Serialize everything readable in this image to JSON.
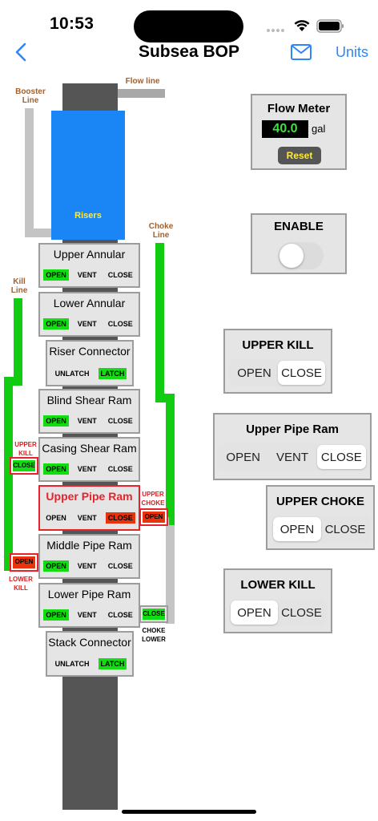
{
  "status": {
    "time": "10:53"
  },
  "nav": {
    "title": "Subsea BOP",
    "units_label": "Units"
  },
  "diagram": {
    "flow_line": "Flow line",
    "booster_line": "Booster Line",
    "risers": "Risers",
    "choke_line": "Choke Line",
    "kill_line": "Kill Line",
    "upper_kill_label": "UPPER KILL",
    "upper_kill_valve": "CLOSE",
    "lower_kill_label": "LOWER KILL",
    "lower_kill_valve": "OPEN",
    "upper_choke_label": "UPPER CHOKE",
    "upper_choke_valve": "OPEN",
    "choke_lower_label": "CHOKE LOWER",
    "choke_lower_valve": "CLOSE"
  },
  "stack": [
    {
      "title": "Upper Annular",
      "opts": [
        "OPEN",
        "VENT",
        "CLOSE"
      ]
    },
    {
      "title": "Lower Annular",
      "opts": [
        "OPEN",
        "VENT",
        "CLOSE"
      ]
    },
    {
      "title": "Riser Connector",
      "opts": [
        "UNLATCH",
        "LATCH"
      ]
    },
    {
      "title": "Blind Shear Ram",
      "opts": [
        "OPEN",
        "VENT",
        "CLOSE"
      ]
    },
    {
      "title": "Casing Shear Ram",
      "opts": [
        "OPEN",
        "VENT",
        "CLOSE"
      ]
    },
    {
      "title": "Upper Pipe Ram",
      "opts": [
        "OPEN",
        "VENT",
        "CLOSE"
      ]
    },
    {
      "title": "Middle Pipe Ram",
      "opts": [
        "OPEN",
        "VENT",
        "CLOSE"
      ]
    },
    {
      "title": "Lower Pipe Ram",
      "opts": [
        "OPEN",
        "VENT",
        "CLOSE"
      ]
    },
    {
      "title": "Stack Connector",
      "opts": [
        "UNLATCH",
        "LATCH"
      ]
    }
  ],
  "flow_meter": {
    "title": "Flow Meter",
    "value": "40.0",
    "unit": "gal",
    "reset": "Reset"
  },
  "enable": {
    "title": "ENABLE",
    "on": false
  },
  "upper_kill": {
    "title": "UPPER KILL",
    "opts": [
      "OPEN",
      "CLOSE"
    ],
    "selected": "CLOSE"
  },
  "upper_pipe_ram": {
    "title": "Upper Pipe Ram",
    "opts": [
      "OPEN",
      "VENT",
      "CLOSE"
    ],
    "selected": "CLOSE"
  },
  "upper_choke": {
    "title": "UPPER CHOKE",
    "opts": [
      "OPEN",
      "CLOSE"
    ],
    "selected": "OPEN"
  },
  "lower_kill": {
    "title": "LOWER KILL",
    "opts": [
      "OPEN",
      "CLOSE"
    ],
    "selected": "OPEN"
  },
  "colors": {
    "accent": "#2f86f6",
    "green": "#11dd11",
    "red": "#e8330c",
    "riser_blue": "#1a86f5"
  }
}
